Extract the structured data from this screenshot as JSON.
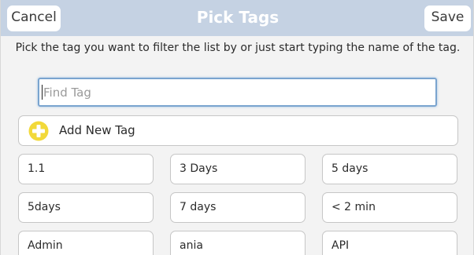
{
  "header": {
    "title": "Pick Tags",
    "cancel_label": "Cancel",
    "save_label": "Save"
  },
  "instructions": "Pick the tag you want to filter the list by or just start typing the name of the tag.",
  "search": {
    "placeholder": "Find Tag",
    "value": ""
  },
  "add_new": {
    "label": "Add New Tag",
    "icon": "plus-circle-icon",
    "icon_color": "#f2d93a"
  },
  "tags": [
    "1.1",
    "3 Days",
    "5 days",
    "5days",
    "7 days",
    "< 2 min",
    "Admin",
    "ania",
    "API"
  ],
  "colors": {
    "header_background": "#c5d2e3",
    "focus_border": "#7aa4cf"
  }
}
